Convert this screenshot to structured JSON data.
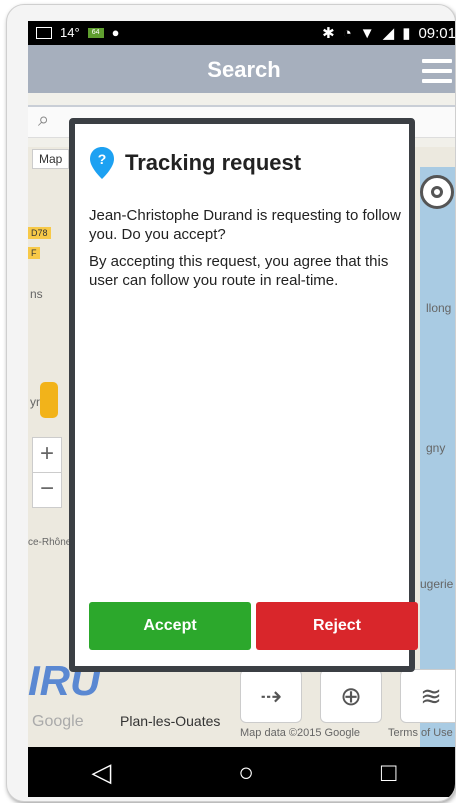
{
  "status_bar": {
    "temperature": "14°",
    "battery_badge": "64",
    "time": "09:01"
  },
  "app_bar": {
    "title": "Search"
  },
  "map": {
    "map_button_label": "Map",
    "road_tags": [
      "D78",
      "F"
    ],
    "place_labels": [
      "ns",
      "yr",
      "llong",
      "gny",
      "ugerie",
      "ce-Rhône"
    ],
    "logo_text": "IRU",
    "plan_label": "Plan-les-Ouates",
    "google_label": "Google",
    "credit": "Map data ©2015 Google",
    "terms": "Terms of Use",
    "zoom_in": "+",
    "zoom_out": "−"
  },
  "dialog": {
    "title": "Tracking request",
    "message": "Jean-Christophe Durand is requesting to follow you. Do you accept?",
    "detail": "By accepting this request, you agree that this user can follow you route in real-time.",
    "accept_label": "Accept",
    "reject_label": "Reject",
    "colors": {
      "accept": "#2ca82c",
      "reject": "#d9262b",
      "pin": "#1da1f2"
    }
  },
  "nav_bar": {
    "back": "◁",
    "home": "○",
    "recents": "□"
  }
}
